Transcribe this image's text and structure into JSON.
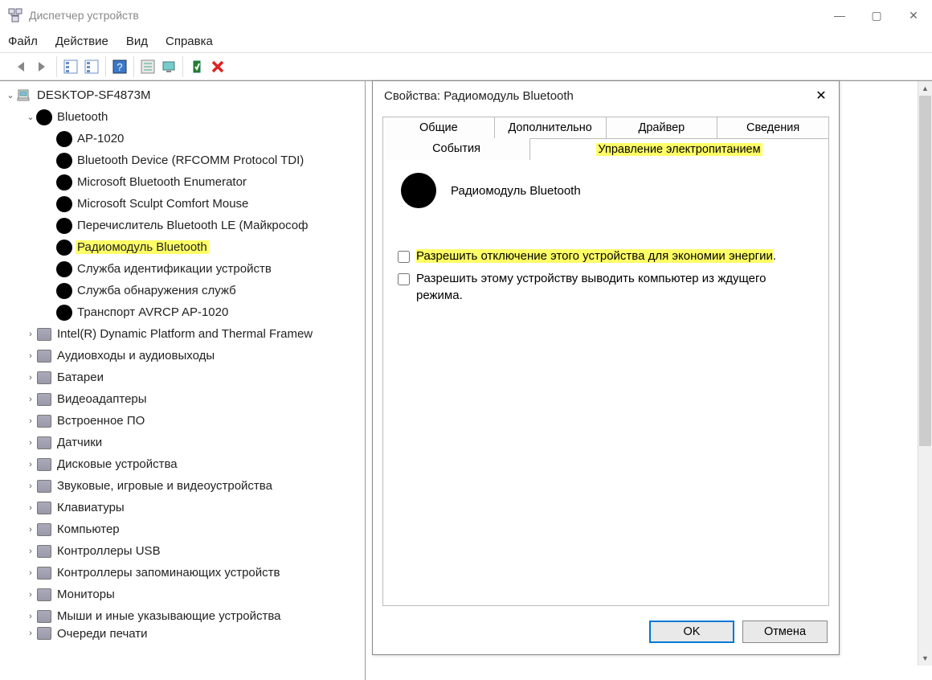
{
  "window": {
    "title": "Диспетчер устройств",
    "controls": {
      "minimize": "—",
      "maximize": "▢",
      "close": "✕"
    }
  },
  "menu": {
    "file": "Файл",
    "action": "Действие",
    "view": "Вид",
    "help": "Справка"
  },
  "tree": {
    "root": "DESKTOP-SF4873M",
    "bluetooth": {
      "label": "Bluetooth",
      "items": [
        "AP-1020",
        "Bluetooth Device (RFCOMM Protocol TDI)",
        "Microsoft Bluetooth Enumerator",
        "Microsoft Sculpt Comfort Mouse",
        "Перечислитель Bluetooth LE (Майкрософ",
        "Радиомодуль Bluetooth",
        "Служба идентификации устройств",
        "Служба обнаружения служб",
        "Транспорт AVRCP AP-1020"
      ],
      "highlight_index": 5
    },
    "categories": [
      "Intel(R) Dynamic Platform and Thermal Framew",
      "Аудиовходы и аудиовыходы",
      "Батареи",
      "Видеоадаптеры",
      "Встроенное ПО",
      "Датчики",
      "Дисковые устройства",
      "Звуковые, игровые и видеоустройства",
      "Клавиатуры",
      "Компьютер",
      "Контроллеры USB",
      "Контроллеры запоминающих устройств",
      "Мониторы",
      "Мыши и иные указывающие устройства",
      "Очереди печати"
    ]
  },
  "dialog": {
    "title": "Свойства: Радиомодуль Bluetooth",
    "tabs_row1": [
      "Общие",
      "Дополнительно",
      "Драйвер",
      "Сведения"
    ],
    "tabs_row2": [
      "События",
      "Управление электропитанием"
    ],
    "active_tab": "Управление электропитанием",
    "device_name": "Радиомодуль Bluetooth",
    "checkbox1": "Разрешить отключение этого устройства для экономии энергии",
    "checkbox1_suffix": ".",
    "checkbox2": "Разрешить этому устройству выводить компьютер из ждущего режима.",
    "buttons": {
      "ok": "OK",
      "cancel": "Отмена"
    }
  },
  "expanders": {
    "open": "⌄",
    "closed": "›"
  }
}
